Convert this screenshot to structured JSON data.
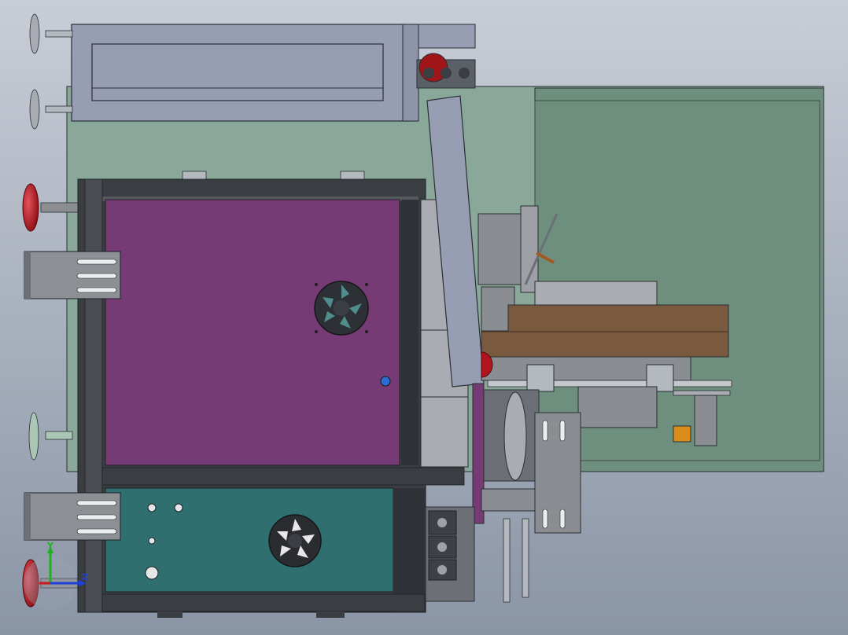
{
  "viewport": {
    "background_top": "#c8cdd6",
    "background_bottom": "#8a95a6"
  },
  "triad": {
    "y_label": "Y",
    "z_label": "Z",
    "x_color": "#d01818",
    "y_color": "#22b022",
    "z_color": "#1f3fd6"
  },
  "colors": {
    "purple_panel": "#763a74",
    "teal_panel": "#2f6f70",
    "green_plate": "#8aa89a",
    "green_plate_dark": "#6e8f7d",
    "frame": "#3a3d42",
    "steel": "#8a8e93",
    "steel_light": "#a9adb3",
    "wood": "#7a5a3e",
    "foot_red": "#b0141c",
    "orange_motor": "#d98c1a",
    "outline": "#2b2e33"
  }
}
